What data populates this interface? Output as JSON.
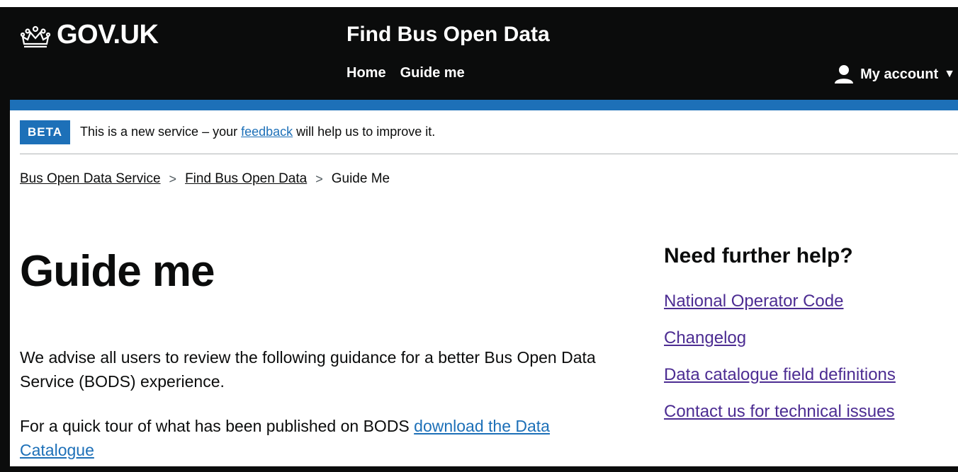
{
  "header": {
    "logo_text": "GOV.UK",
    "service_name": "Find Bus Open Data",
    "nav": [
      {
        "label": "Home"
      },
      {
        "label": "Guide me"
      }
    ],
    "account_label": "My account",
    "account_chevron": "▼"
  },
  "beta": {
    "tag": "BETA",
    "text_before": "This is a new service – your ",
    "link": "feedback",
    "text_after": " will help us to improve it."
  },
  "breadcrumbs": {
    "items": [
      {
        "label": "Bus Open Data Service"
      },
      {
        "label": "Find Bus Open Data"
      }
    ],
    "current": "Guide Me",
    "separator": ">"
  },
  "main": {
    "title": "Guide me",
    "intro": "We advise all users to review the following guidance for a better Bus Open Data Service (BODS) experience.",
    "quick_tour_text": "For a quick tour of what has been published on BODS ",
    "quick_tour_link": "download the Data Catalogue"
  },
  "sidebar": {
    "heading": "Need further help?",
    "links": [
      {
        "label": "National Operator Code"
      },
      {
        "label": "Changelog"
      },
      {
        "label": "Data catalogue field definitions"
      },
      {
        "label": "Contact us for technical issues"
      }
    ]
  },
  "colors": {
    "header_bg": "#0b0c0c",
    "brand_blue": "#1d70b8",
    "link": "#1d70b8",
    "visited_link": "#4c2c92",
    "text": "#0b0c0c"
  },
  "icons": {
    "logo": "crown-icon",
    "account": "user-icon",
    "dropdown": "chevron-down-icon",
    "breadcrumb_separator": "chevron-right-icon"
  }
}
